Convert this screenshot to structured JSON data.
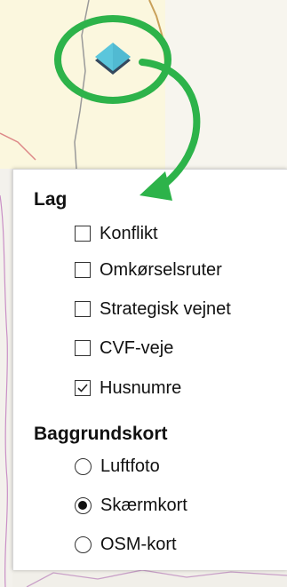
{
  "layers": {
    "title": "Lag",
    "items": [
      {
        "label": "Konflikt",
        "checked": false
      },
      {
        "label": "Omkørselsruter",
        "checked": false
      },
      {
        "label": "Strategisk vejnet",
        "checked": false
      },
      {
        "label": "CVF-veje",
        "checked": false
      },
      {
        "label": "Husnumre",
        "checked": true
      }
    ]
  },
  "basemap": {
    "title": "Baggrundskort",
    "options": [
      {
        "label": "Luftfoto",
        "selected": false
      },
      {
        "label": "Skærmkort",
        "selected": true
      },
      {
        "label": "OSM-kort",
        "selected": false
      }
    ]
  },
  "colors": {
    "highlight_green": "#2db34a",
    "layer_icon_top": "#5bc6dc",
    "layer_icon_bottom": "#34495e"
  },
  "icons": {
    "layer_button": "layers-icon",
    "arrow": "curved-arrow-icon"
  }
}
